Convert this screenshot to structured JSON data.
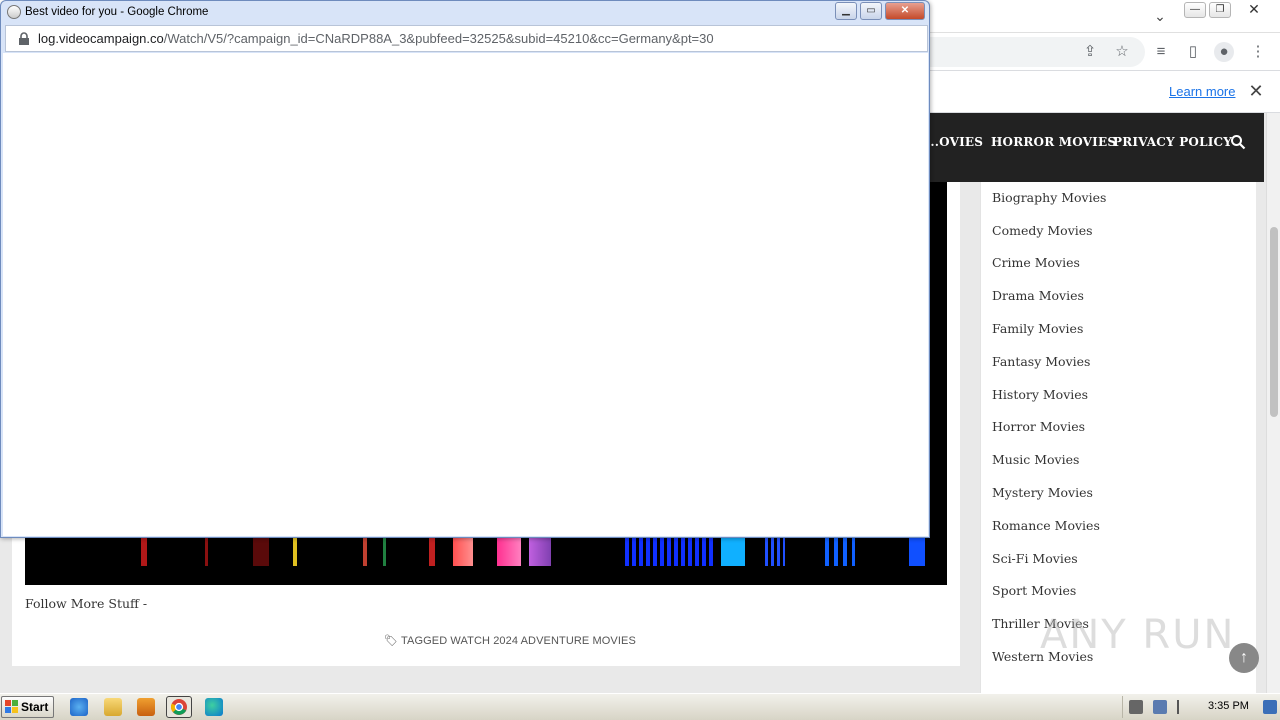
{
  "popup": {
    "title": "Best video for you - Google Chrome",
    "url_host": "log.videocampaign.co",
    "url_path": "/Watch/V5/?campaign_id=CNaRDP88A_3&pubfeed=32525&subid=45210&cc=Germany&pt=30"
  },
  "infobar": {
    "learn_more": "Learn more"
  },
  "nav": {
    "items": [
      "...OVIES",
      "HORROR MOVIES",
      "PRIVACY POLICY"
    ]
  },
  "content": {
    "follow_text": "Follow More Stuff -",
    "tagged_text": "TAGGED WATCH 2024 ADVENTURE MOVIES"
  },
  "sidebar": {
    "categories": [
      "Biography Movies",
      "Comedy Movies",
      "Crime Movies",
      "Drama Movies",
      "Family Movies",
      "Fantasy Movies",
      "History Movies",
      "Horror Movies",
      "Music Movies",
      "Mystery Movies",
      "Romance Movies",
      "Sci-Fi Movies",
      "Sport Movies",
      "Thriller Movies",
      "Western Movies"
    ]
  },
  "watermark": "ANY RUN",
  "taskbar": {
    "start_label": "Start",
    "clock": "3:35 PM"
  }
}
